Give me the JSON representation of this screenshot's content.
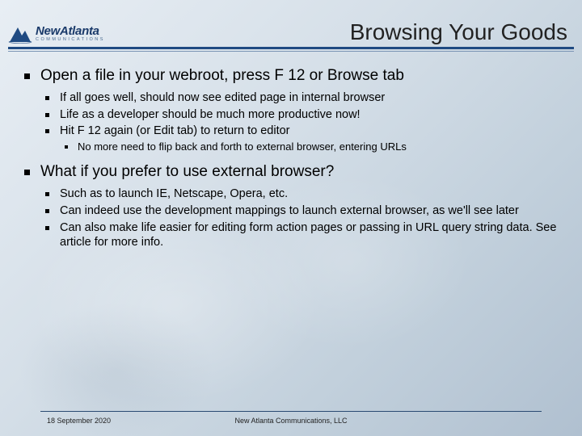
{
  "header": {
    "logo_main": "NewAtlanta",
    "logo_sub": "COMMUNICATIONS",
    "title": "Browsing Your Goods"
  },
  "content": {
    "items": [
      {
        "text": "Open a file in your webroot, press F 12 or Browse tab",
        "children": [
          {
            "text": "If all goes well, should now see edited page in internal browser"
          },
          {
            "text": "Life as a developer should be much more productive now!"
          },
          {
            "text": "Hit F 12 again (or Edit tab) to return to editor",
            "children": [
              {
                "text": "No more need to flip back and forth to external browser, entering URLs"
              }
            ]
          }
        ]
      },
      {
        "text": "What if you prefer to use external browser?",
        "children": [
          {
            "text": "Such as to launch IE, Netscape, Opera, etc."
          },
          {
            "text": "Can indeed use the development mappings to launch external browser, as we'll see later"
          },
          {
            "text": "Can also make life easier for editing form action pages or passing in URL query string data. See article for more info."
          }
        ]
      }
    ]
  },
  "footer": {
    "date": "18 September 2020",
    "org": "New Atlanta Communications, LLC"
  }
}
